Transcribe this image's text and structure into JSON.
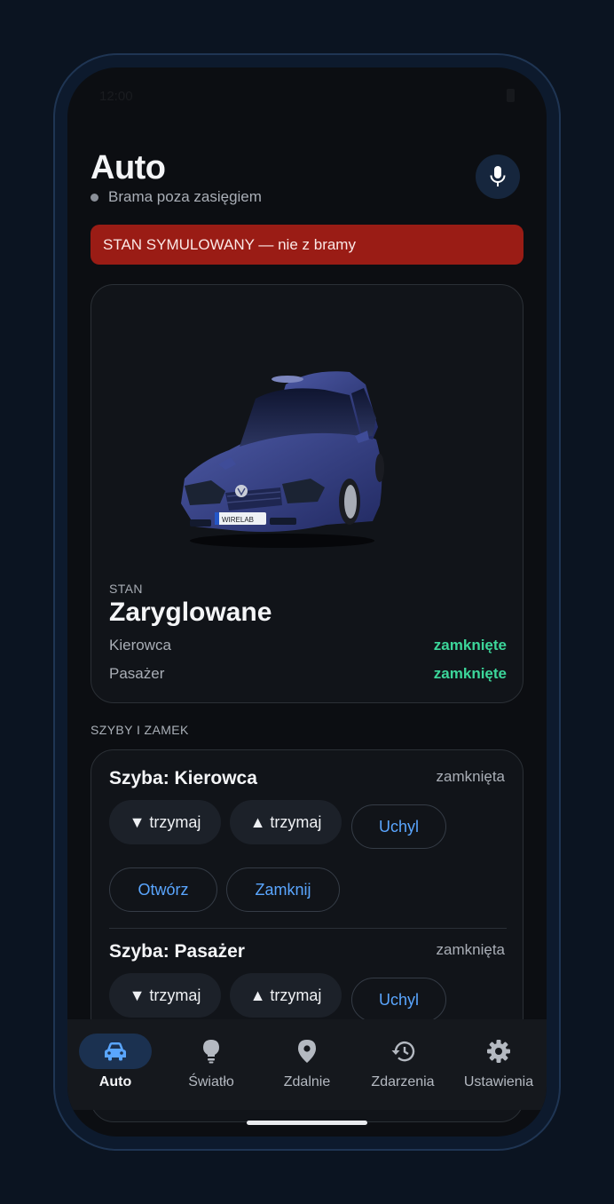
{
  "status_bar": {
    "time": "12:00"
  },
  "header": {
    "title": "Auto",
    "gateway_status": "Brama poza zasięgiem",
    "mic_icon": "microphone-icon"
  },
  "banner": {
    "text": "STAN SYMULOWANY — nie z bramy",
    "color": "#9a1c15"
  },
  "car": {
    "plate_text": "WIRELAB",
    "state_caption": "STAN",
    "state_value": "Zaryglowane",
    "doors": [
      {
        "label": "Kierowca",
        "status": "zamknięte"
      },
      {
        "label": "Pasażer",
        "status": "zamknięte"
      }
    ]
  },
  "section_label": "SZYBY I ZAMEK",
  "windows": [
    {
      "title": "Szyba: Kierowca",
      "status": "zamknięta",
      "down_label": "▼ trzymaj",
      "up_label": "▲ trzymaj",
      "vent_label": "Uchyl",
      "open_label": "Otwórz",
      "close_label": "Zamknij"
    },
    {
      "title": "Szyba: Pasażer",
      "status": "zamknięta",
      "down_label": "▼ trzymaj",
      "up_label": "▲ trzymaj",
      "vent_label": "Uchyl"
    }
  ],
  "nav": {
    "items": [
      {
        "label": "Auto",
        "icon": "car-icon",
        "active": true
      },
      {
        "label": "Światło",
        "icon": "lightbulb-icon",
        "active": false
      },
      {
        "label": "Zdalnie",
        "icon": "location-pin-icon",
        "active": false
      },
      {
        "label": "Zdarzenia",
        "icon": "history-icon",
        "active": false
      },
      {
        "label": "Ustawienia",
        "icon": "gear-icon",
        "active": false
      }
    ]
  },
  "colors": {
    "accent": "#5aa6ff",
    "status_ok": "#3cd69a",
    "background": "#0c0e12",
    "nav_active": "#1b3150"
  }
}
